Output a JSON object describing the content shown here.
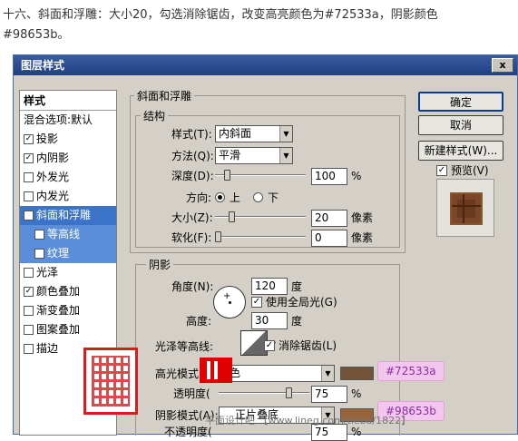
{
  "intro": {
    "line1": "十六、斜面和浮雕：大小20，勾选消除锯齿，改变高亮颜色为#72533a，阴影颜色",
    "line2": "#98653b。"
  },
  "dialog": {
    "title": "图层样式",
    "close": "x",
    "styles_header": "样式",
    "blend_options": "混合选项:默认",
    "style_items": [
      {
        "label": "投影",
        "checked": true
      },
      {
        "label": "内阴影",
        "checked": true
      },
      {
        "label": "外发光",
        "checked": false
      },
      {
        "label": "内发光",
        "checked": false
      },
      {
        "label": "斜面和浮雕",
        "checked": true,
        "selected": true
      },
      {
        "label": "等高线",
        "checked": true,
        "sub": true
      },
      {
        "label": "纹理",
        "checked": true,
        "sub": true
      },
      {
        "label": "光泽",
        "checked": false
      },
      {
        "label": "颜色叠加",
        "checked": true
      },
      {
        "label": "渐变叠加",
        "checked": false
      },
      {
        "label": "图案叠加",
        "checked": false
      },
      {
        "label": "描边",
        "checked": false
      }
    ],
    "buttons": {
      "ok": "确定",
      "cancel": "取消",
      "new_style": "新建样式(W)...",
      "preview": "预览(V)"
    },
    "bevel": {
      "section_title": "斜面和浮雕",
      "structure_title": "结构",
      "style_label": "样式(T):",
      "style_value": "内斜面",
      "method_label": "方法(Q):",
      "method_value": "平滑",
      "depth_label": "深度(D):",
      "depth_value": "100",
      "depth_unit": "%",
      "direction_label": "方向:",
      "dir_up": "上",
      "dir_down": "下",
      "size_label": "大小(Z):",
      "size_value": "20",
      "size_unit": "像素",
      "soften_label": "软化(F):",
      "soften_value": "0",
      "soften_unit": "像素"
    },
    "shading": {
      "title": "阴影",
      "angle_label": "角度(N):",
      "angle_value": "120",
      "angle_unit": "度",
      "global_light": "使用全局光(G)",
      "altitude_label": "高度:",
      "altitude_value": "30",
      "altitude_unit": "度",
      "gloss_label": "光泽等高线:",
      "antialias": "消除锯齿(L)",
      "highlight_label": "高光模式(",
      "highlight_value": "色",
      "highlight_opacity_label": "透明度(",
      "highlight_opacity": "75",
      "pct": "%",
      "shadow_label": "阴影模式(A):",
      "shadow_value": "正片叠底",
      "shadow_opacity_label": "不透明度(",
      "shadow_opacity": "75",
      "highlight_color": "#72533a",
      "shadow_color": "#98653b"
    },
    "tags": {
      "highlight": "#72533a",
      "shadow": "#98653b"
    },
    "watermark": "平面设计吧 【www.lineg.com/tieba/1822】"
  }
}
